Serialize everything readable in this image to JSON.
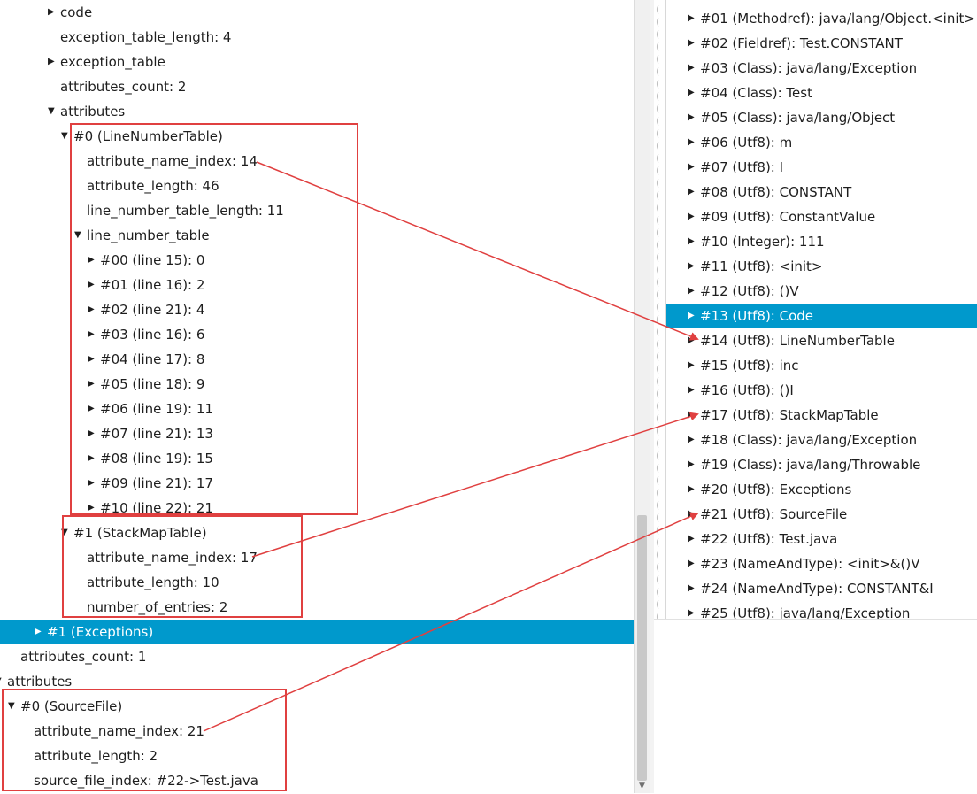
{
  "left_tree": [
    {
      "indent": 54,
      "arrow": "right",
      "text": "code"
    },
    {
      "indent": 54,
      "arrow": "",
      "text": "exception_table_length: 4"
    },
    {
      "indent": 54,
      "arrow": "right",
      "text": "exception_table"
    },
    {
      "indent": 54,
      "arrow": "",
      "text": "attributes_count: 2"
    },
    {
      "indent": 54,
      "arrow": "down",
      "text": "attributes"
    },
    {
      "indent": 69,
      "arrow": "down",
      "text": "#0 (LineNumberTable)"
    },
    {
      "indent": 84,
      "arrow": "",
      "text": "attribute_name_index: 14"
    },
    {
      "indent": 84,
      "arrow": "",
      "text": "attribute_length: 46"
    },
    {
      "indent": 84,
      "arrow": "",
      "text": "line_number_table_length: 11"
    },
    {
      "indent": 84,
      "arrow": "down",
      "text": "line_number_table"
    },
    {
      "indent": 99,
      "arrow": "right",
      "text": "#00 (line 15): 0"
    },
    {
      "indent": 99,
      "arrow": "right",
      "text": "#01 (line 16): 2"
    },
    {
      "indent": 99,
      "arrow": "right",
      "text": "#02 (line 21): 4"
    },
    {
      "indent": 99,
      "arrow": "right",
      "text": "#03 (line 16): 6"
    },
    {
      "indent": 99,
      "arrow": "right",
      "text": "#04 (line 17): 8"
    },
    {
      "indent": 99,
      "arrow": "right",
      "text": "#05 (line 18): 9"
    },
    {
      "indent": 99,
      "arrow": "right",
      "text": "#06 (line 19): 11"
    },
    {
      "indent": 99,
      "arrow": "right",
      "text": "#07 (line 21): 13"
    },
    {
      "indent": 99,
      "arrow": "right",
      "text": "#08 (line 19): 15"
    },
    {
      "indent": 99,
      "arrow": "right",
      "text": "#09 (line 21): 17"
    },
    {
      "indent": 99,
      "arrow": "right",
      "text": "#10 (line 22): 21"
    },
    {
      "indent": 69,
      "arrow": "down",
      "text": "#1 (StackMapTable)"
    },
    {
      "indent": 84,
      "arrow": "",
      "text": "attribute_name_index: 17"
    },
    {
      "indent": 84,
      "arrow": "",
      "text": "attribute_length: 10"
    },
    {
      "indent": 84,
      "arrow": "",
      "text": "number_of_entries: 2"
    },
    {
      "indent": 39,
      "arrow": "right",
      "text": "#1 (Exceptions)",
      "selected": true
    },
    {
      "indent": 9,
      "arrow": "",
      "text": "attributes_count: 1"
    },
    {
      "indent": -6,
      "arrow": "down",
      "text": "attributes"
    },
    {
      "indent": 9,
      "arrow": "down",
      "text": "#0 (SourceFile)"
    },
    {
      "indent": 24,
      "arrow": "",
      "text": "attribute_name_index: 21"
    },
    {
      "indent": 24,
      "arrow": "",
      "text": "attribute_length: 2"
    },
    {
      "indent": 24,
      "arrow": "",
      "text": "source_file_index: #22->Test.java"
    }
  ],
  "constant_pool": [
    {
      "text": "#01 (Methodref): java/lang/Object.<init>"
    },
    {
      "text": "#02 (Fieldref): Test.CONSTANT"
    },
    {
      "text": "#03 (Class): java/lang/Exception"
    },
    {
      "text": "#04 (Class): Test"
    },
    {
      "text": "#05 (Class): java/lang/Object"
    },
    {
      "text": "#06 (Utf8): m"
    },
    {
      "text": "#07 (Utf8): I"
    },
    {
      "text": "#08 (Utf8): CONSTANT"
    },
    {
      "text": "#09 (Utf8): ConstantValue"
    },
    {
      "text": "#10 (Integer): 111"
    },
    {
      "text": "#11 (Utf8): <init>"
    },
    {
      "text": "#12 (Utf8): ()V"
    },
    {
      "text": "#13 (Utf8): Code",
      "selected": true
    },
    {
      "text": "#14 (Utf8): LineNumberTable"
    },
    {
      "text": "#15 (Utf8): inc"
    },
    {
      "text": "#16 (Utf8): ()I"
    },
    {
      "text": "#17 (Utf8): StackMapTable"
    },
    {
      "text": "#18 (Class): java/lang/Exception"
    },
    {
      "text": "#19 (Class): java/lang/Throwable"
    },
    {
      "text": "#20 (Utf8): Exceptions"
    },
    {
      "text": "#21 (Utf8): SourceFile"
    },
    {
      "text": "#22 (Utf8): Test.java"
    },
    {
      "text": "#23 (NameAndType): <init>&()V"
    },
    {
      "text": "#24 (NameAndType): CONSTANT&I"
    },
    {
      "text": "#25 (Utf8): java/lang/Exception"
    }
  ],
  "colors": {
    "selection": "#0099cc",
    "annotation": "#e04040"
  }
}
